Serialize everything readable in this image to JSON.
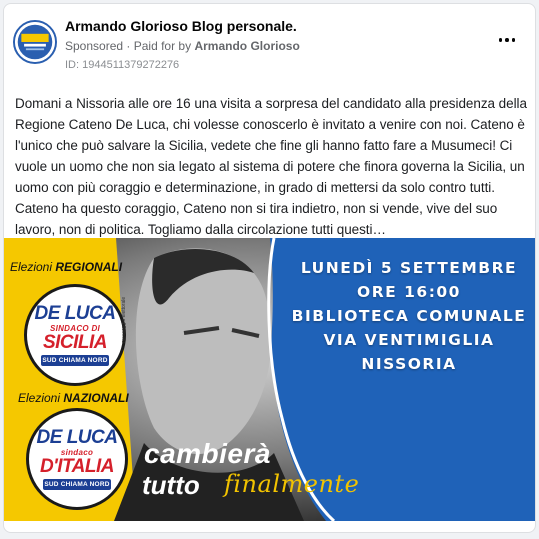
{
  "post": {
    "page_name": "Armando Glorioso Blog personale.",
    "sponsored": "Sponsored",
    "separator": "·",
    "paid_for_prefix": "Paid for by",
    "payer": "Armando Glorioso",
    "ad_id": "ID: 1944511379272276",
    "more_icon": "more-horizontal-icon",
    "text": "Domani a Nissoria alle ore 16 una visita a sorpresa del candidato alla presidenza della Regione Cateno De Luca, chi volesse conoscerlo è invitato a venire con noi. Cateno è l'unico che può salvare la Sicilia, vedete che fine gli hanno fatto fare a Musumeci! Ci vuole un uomo che non sia legato al sistema di potere che finora governa la Sicilia, un uomo con più coraggio e determinazione, in grado di mettersi da solo contro tutti. Cateno ha questo coraggio, Cateno non si tira indietro, non si vende, vive del suo lavoro, non di politica. Togliamo dalla circolazione tutti questi…"
  },
  "image": {
    "event_lines": [
      "Lunedì 5 settembre",
      "Ore 16:00",
      "Biblioteca Comunale",
      "Via ventimiglia",
      "Nissoria"
    ],
    "regionali_prefix": "Elezioni",
    "regionali_word": "REGIONALI",
    "nazionali_prefix": "Elezioni",
    "nazionali_word": "NAZIONALI",
    "badge1": {
      "name": "DE LUCA",
      "sub": "SINDACO DI",
      "region": "SICILIA",
      "tag": "SUD CHIAMA NORD"
    },
    "badge2": {
      "name": "DE LUCA",
      "sub": "sindaco",
      "region": "D'ITALIA",
      "tag": "SUD CHIAMA NORD"
    },
    "side_note": "messaggio elettorale",
    "slogan_line1": "cambierà",
    "slogan_line2": "tutto",
    "slogan_line3": "finalmente"
  },
  "colors": {
    "yellow": "#f5c800",
    "blue": "#1f62b8",
    "navy": "#1c3f94",
    "red": "#d5202b"
  }
}
